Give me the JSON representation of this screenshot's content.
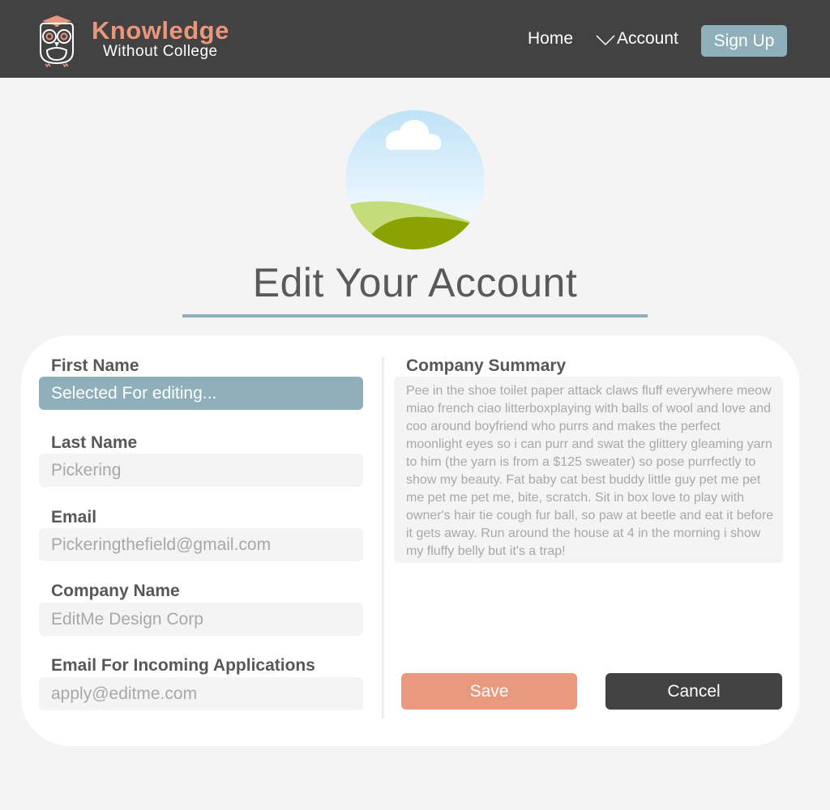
{
  "header": {
    "brand_title": "Knowledge",
    "brand_subtitle": "Without College",
    "nav_home": "Home",
    "nav_account": "Account",
    "signup_label": "Sign Up"
  },
  "page": {
    "title": "Edit Your Account"
  },
  "form": {
    "first_name": {
      "label": "First Name",
      "value": "Selected For editing..."
    },
    "last_name": {
      "label": "Last Name",
      "value": "Pickering"
    },
    "email": {
      "label": "Email",
      "value": "Pickeringthefield@gmail.com"
    },
    "company_name": {
      "label": "Company Name",
      "value": "EditMe Design Corp"
    },
    "apply_email": {
      "label": "Email For Incoming Applications",
      "value": "apply@editme.com"
    },
    "summary": {
      "label": "Company Summary",
      "value": "Pee in the shoe toilet paper attack claws fluff everywhere meow miao french ciao litterboxplaying with balls of wool and love and coo around boyfriend who purrs and makes the perfect moonlight eyes so i can purr and swat the glittery gleaming yarn to him (the yarn is from a $125 sweater) so pose purrfectly to show my beauty. Fat baby cat best buddy little guy pet me pet me pet me pet me, bite, scratch. Sit in box love to play with owner's hair tie cough fur ball, so paw at beetle and eat it before it gets away. Run around the house at 4 in the morning i show my fluffy belly but it's a trap!"
    }
  },
  "actions": {
    "save_label": "Save",
    "cancel_label": "Cancel"
  },
  "icons": {
    "logo": "owl-logo-icon",
    "account_dropdown": "chevron-down-icon",
    "avatar": "landscape-image-icon"
  },
  "colors": {
    "header_bg": "#424242",
    "brand_accent": "#e8967c",
    "accent_blue": "#8fb0ba",
    "save_button": "#e8997e",
    "cancel_button": "#424242",
    "page_bg": "#f4f4f4"
  }
}
